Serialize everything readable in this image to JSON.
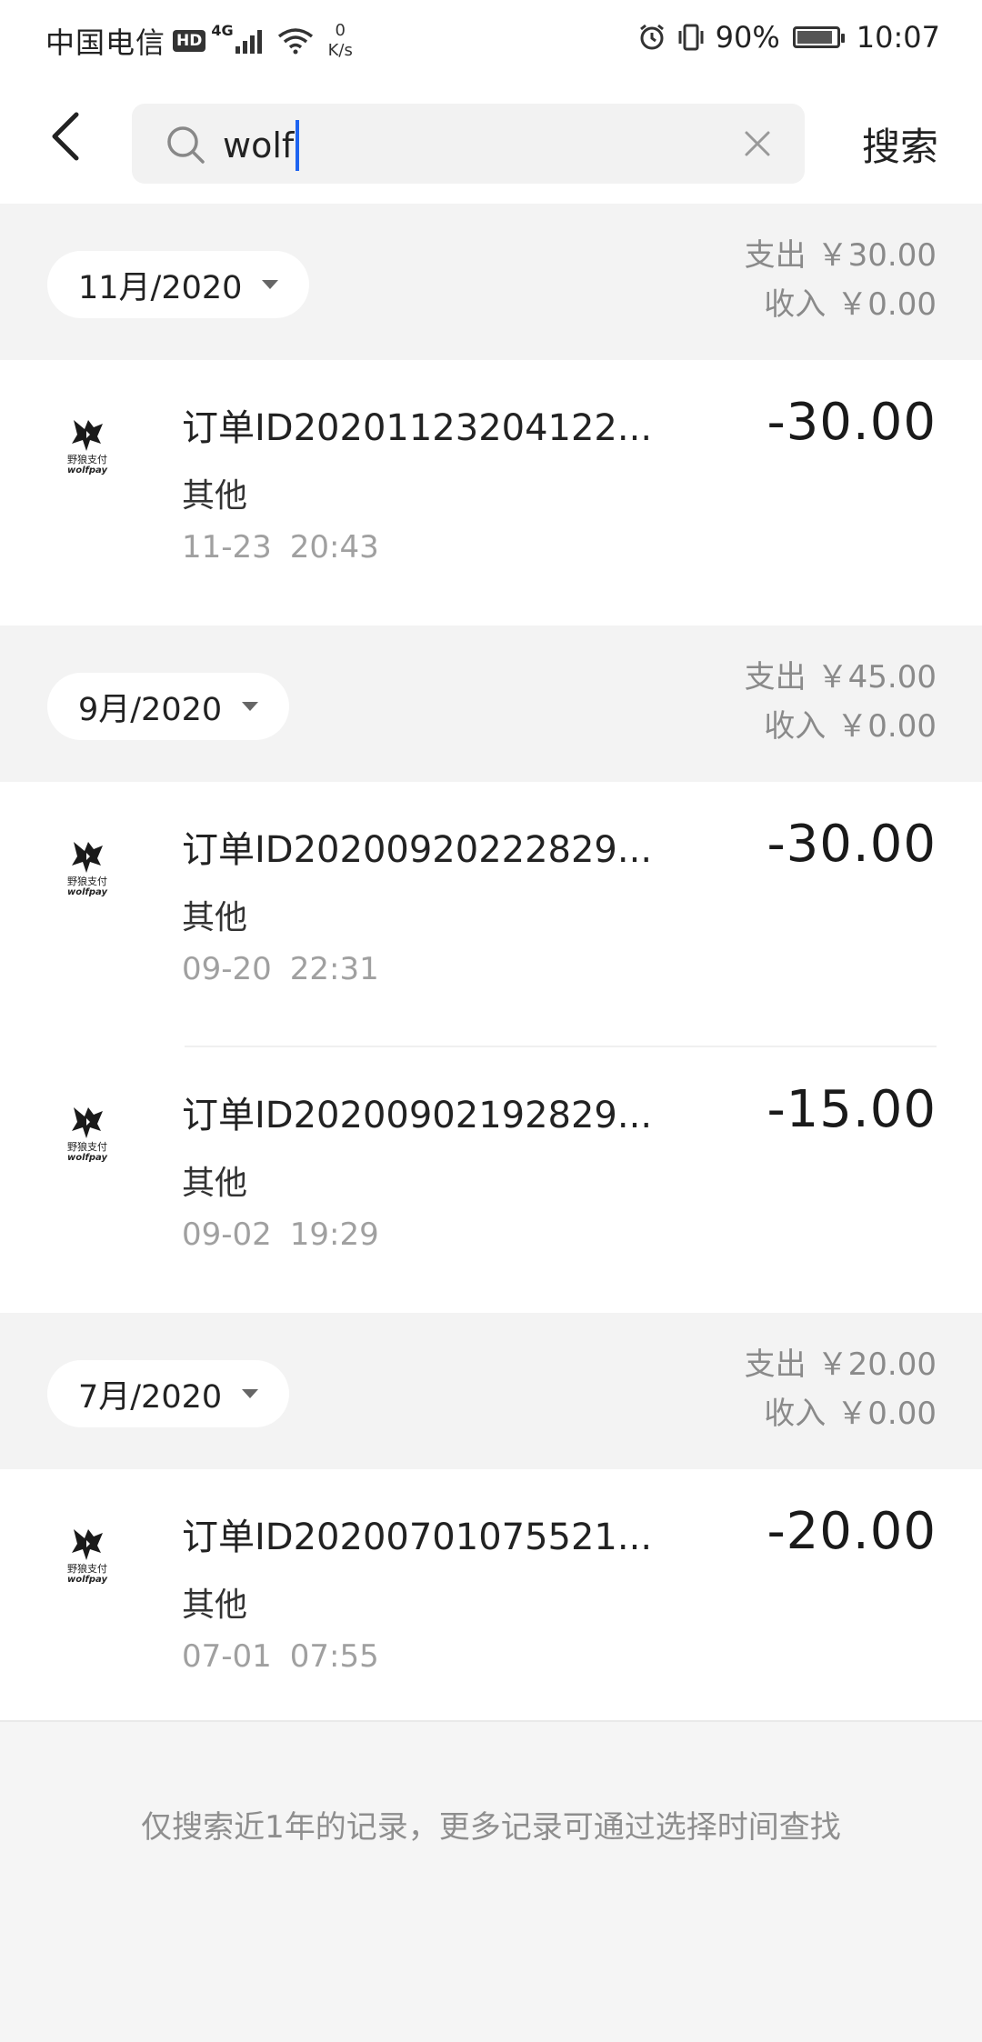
{
  "status_bar": {
    "carrier": "中国电信",
    "hd": "HD",
    "network": "4G",
    "speed_value": "0",
    "speed_unit": "K/s",
    "battery_percent": "90%",
    "battery_level": 0.9,
    "time": "10:07"
  },
  "search": {
    "query": "wolf",
    "search_label": "搜索"
  },
  "groups": [
    {
      "month": "11月/2020",
      "expense_label": "支出",
      "expense": "￥30.00",
      "income_label": "收入",
      "income": "￥0.00",
      "transactions": [
        {
          "title": "订单ID20201123204122...",
          "category": "其他",
          "date": "11-23",
          "time": "20:43",
          "amount": "-30.00"
        }
      ]
    },
    {
      "month": "9月/2020",
      "expense_label": "支出",
      "expense": "￥45.00",
      "income_label": "收入",
      "income": "￥0.00",
      "transactions": [
        {
          "title": "订单ID20200920222829...",
          "category": "其他",
          "date": "09-20",
          "time": "22:31",
          "amount": "-30.00"
        },
        {
          "title": "订单ID20200902192829...",
          "category": "其他",
          "date": "09-02",
          "time": "19:29",
          "amount": "-15.00"
        }
      ]
    },
    {
      "month": "7月/2020",
      "expense_label": "支出",
      "expense": "￥20.00",
      "income_label": "收入",
      "income": "￥0.00",
      "transactions": [
        {
          "title": "订单ID20200701075521...",
          "category": "其他",
          "date": "07-01",
          "time": "07:55",
          "amount": "-20.00"
        }
      ]
    }
  ],
  "merchant_logo": {
    "name_cn": "野狼支付",
    "name_en": "wolfpay",
    "icon": "wolf-logo-icon"
  },
  "footer": {
    "note": "仅搜索近1年的记录，更多记录可通过选择时间查找"
  },
  "colors": {
    "caret": "#1e64f0",
    "group_bg": "#f3f3f3",
    "muted_text": "#8a8a8a"
  }
}
